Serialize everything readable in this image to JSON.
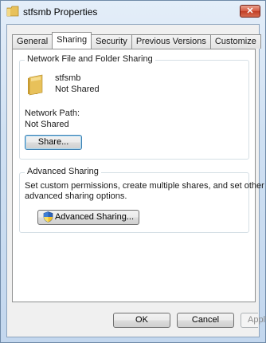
{
  "window": {
    "title": "stfsmb Properties",
    "close_label": "✕"
  },
  "tabs": [
    {
      "label": "General"
    },
    {
      "label": "Sharing"
    },
    {
      "label": "Security"
    },
    {
      "label": "Previous Versions"
    },
    {
      "label": "Customize"
    }
  ],
  "network_sharing": {
    "group_title": "Network File and Folder Sharing",
    "folder_name": "stfsmb",
    "status": "Not Shared",
    "path_label": "Network Path:",
    "path_value": "Not Shared",
    "share_button": "Share..."
  },
  "advanced_sharing": {
    "group_title": "Advanced Sharing",
    "description_line1": "Set custom permissions, create multiple shares, and set other",
    "description_line2": "advanced sharing options.",
    "button": "Advanced Sharing..."
  },
  "footer": {
    "ok": "OK",
    "cancel": "Cancel",
    "apply": "Apply"
  },
  "colors": {
    "folder": "#e8c15a",
    "close_button": "#c9482d",
    "focus_border": "#3c7fb1"
  },
  "icons": {
    "title": "folder-icon",
    "close": "close-icon",
    "folder": "folder-icon",
    "advanced_button": "uac-shield-icon"
  }
}
